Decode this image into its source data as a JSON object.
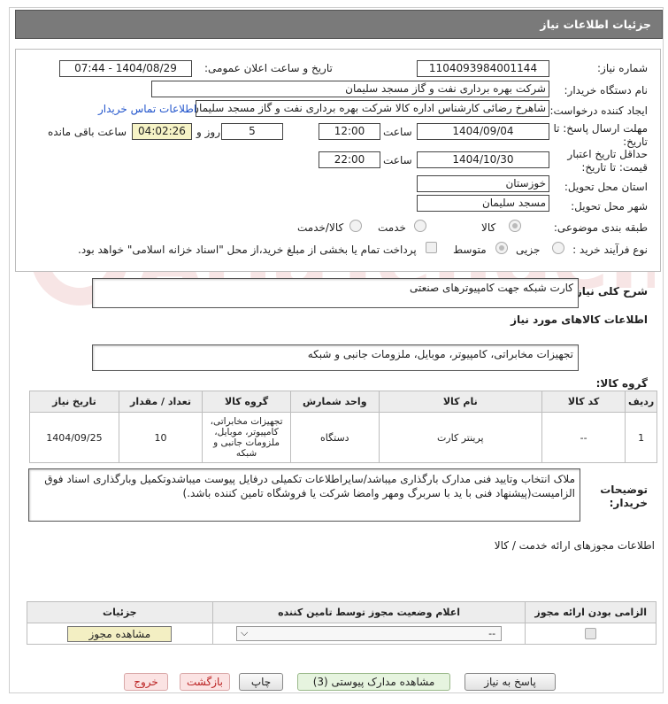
{
  "header": {
    "title": "جزئیات اطلاعات نیاز"
  },
  "form": {
    "need_number_label": "شماره نیاز:",
    "need_number": "1104093984001144",
    "announce_label": "تاریخ و ساعت اعلان عمومی:",
    "announce_value": "1404/08/29 - 07:44",
    "buyer_label": "نام دستگاه خریدار:",
    "buyer_value": "شرکت بهره برداری نفت و گاز مسجد سلیمان",
    "creator_label": "ایجاد کننده درخواست:",
    "creator_value": "شاهرخ رضائی کارشناس اداره کالا شرکت بهره برداری نفت و گاز مسجد سلیمان",
    "contact_link": "اطلاعات تماس خریدار",
    "deadline_label_1": "مهلت ارسال پاسخ: تا",
    "deadline_label_2": "تاریخ:",
    "deadline_date": "1404/09/04",
    "time_label": "ساعت",
    "deadline_time": "12:00",
    "days_value": "5",
    "days_label": "روز و",
    "remaining_value": "04:02:26",
    "remaining_label": "ساعت باقی مانده",
    "validity_label_1": "حداقل تاریخ اعتبار",
    "validity_label_2": "قیمت: تا تاریخ:",
    "validity_date": "1404/10/30",
    "validity_time": "22:00",
    "province_label": "استان محل تحویل:",
    "province_value": "خوزستان",
    "city_label": "شهر محل تحویل:",
    "city_value": "مسجد سلیمان",
    "category_label": "طبقه بندی موضوعی:",
    "category_options": [
      "کالا",
      "خدمت",
      "کالا/خدمت"
    ],
    "process_label": "نوع فرآیند خرید :",
    "process_options": [
      "جزیی",
      "متوسط"
    ],
    "payment_note": "پرداخت تمام یا بخشی از مبلغ خرید،از محل \"اسناد خزانه اسلامی\" خواهد بود."
  },
  "summary": {
    "label": "شرح کلی نیاز:",
    "value": "کارت شبکه جهت کامپیوترهای صنعتی",
    "goods_info_title": "اطلاعات کالاهای مورد نیاز",
    "group_label": "گروه کالا:",
    "group_value": "تجهیزات مخابراتی، کامپیوتر، موبایل، ملزومات جانبی و شبکه"
  },
  "items_table": {
    "headers": [
      "ردیف",
      "کد کالا",
      "نام کالا",
      "واحد شمارش",
      "گروه کالا",
      "تعداد / مقدار",
      "تاریخ نیاز"
    ],
    "rows": [
      {
        "row": "1",
        "code": "--",
        "name": "پرینتر کارت",
        "unit": "دستگاه",
        "group": "تجهیزات مخابراتی، کامپیوتر، موبایل، ملزومات جانبی و شبکه",
        "qty": "10",
        "date": "1404/09/25"
      }
    ]
  },
  "buyer_notes": {
    "label_1": "توضیحات",
    "label_2": "خریدار:",
    "value": "ملاک انتخاب وتایید فنی مدارک بارگذاری میباشد/سایراطلاعات تکمیلی درفایل پیوست میباشدوتکمیل وبارگذاری اسناد فوق الزامیست(پیشنهاد فنی  با ید با سربرگ ومهر وامضا   شرکت یا فروشگاه تامین کننده باشد.)"
  },
  "permits": {
    "title": "اطلاعات مجوزهای ارائه خدمت / کالا",
    "headers": [
      "الزامی بودن ارائه مجوز",
      "اعلام وضعیت مجوز توسط تامین کننده",
      "جزئیات"
    ],
    "select_value": "--",
    "view_button": "مشاهده مجوز"
  },
  "buttons": {
    "reply": "پاسخ به نیاز",
    "attachments": "مشاهده مدارک پیوستی (3)",
    "print": "چاپ",
    "back": "بازگشت",
    "exit": "خروج"
  },
  "watermark": {
    "text": "AriaTender.neT"
  }
}
